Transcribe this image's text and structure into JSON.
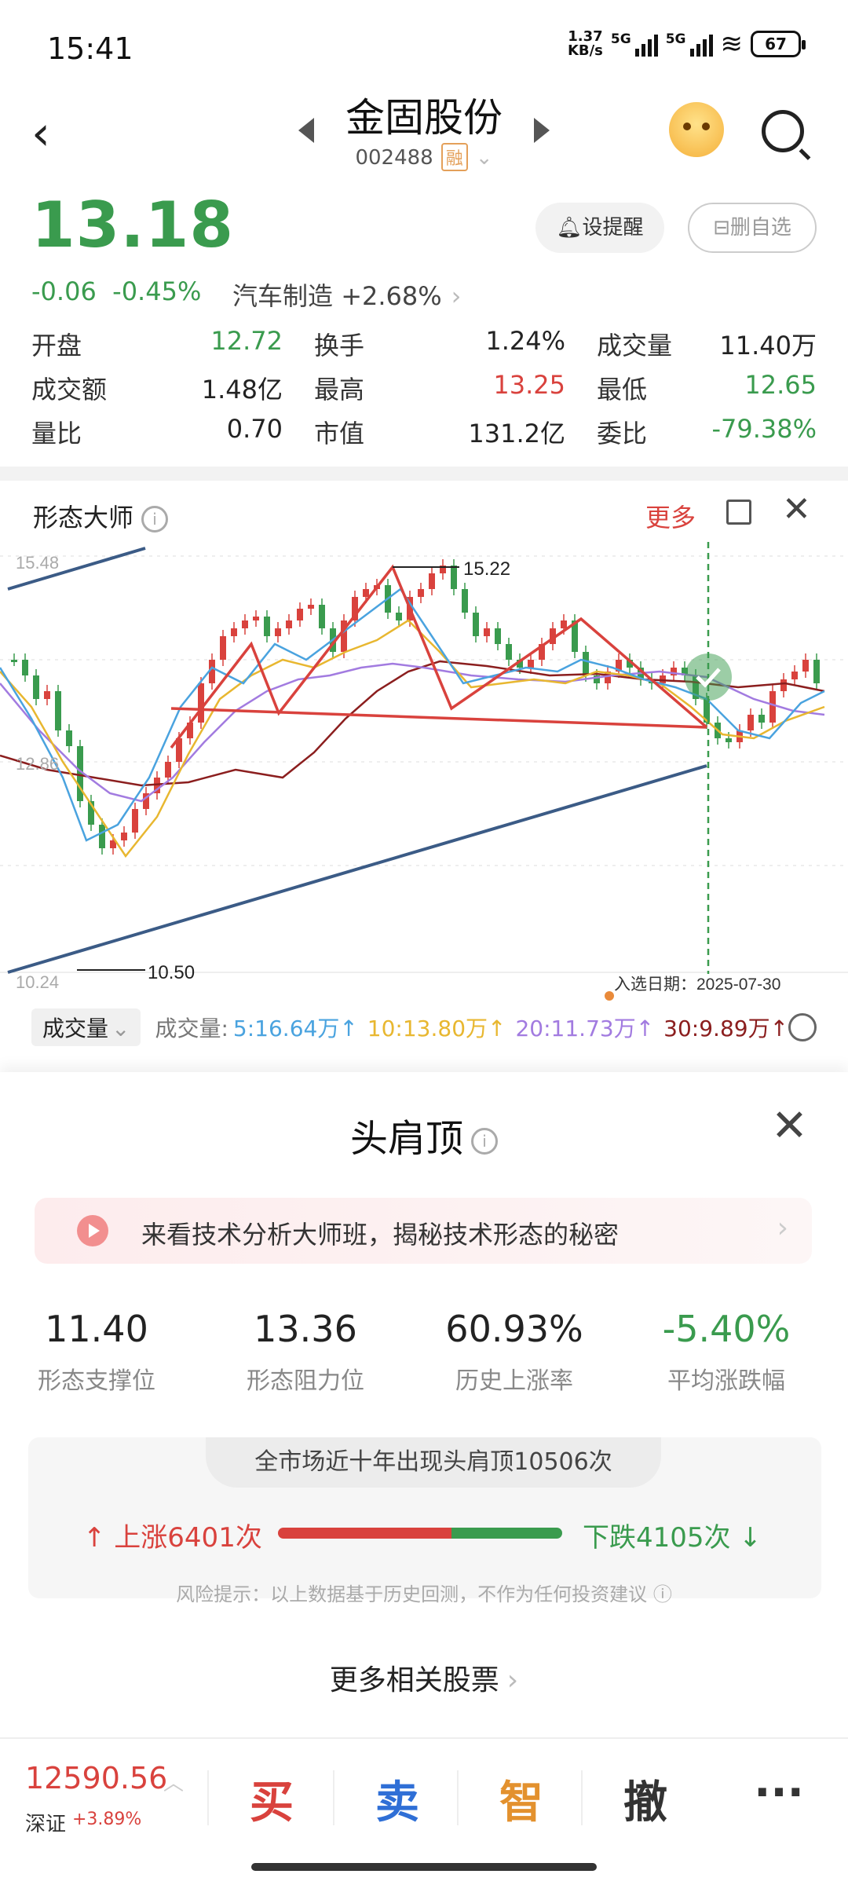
{
  "status_bar": {
    "time": "15:41",
    "net_speed_top": "1.37",
    "net_speed_unit": "KB/s",
    "sim1": "5G",
    "sim2": "5G",
    "battery": "67"
  },
  "header": {
    "stock_name": "金固股份",
    "stock_code": "002488",
    "margin_badge": "融"
  },
  "quote": {
    "price": "13.18",
    "change": "-0.06",
    "change_pct": "-0.45%",
    "sector": "汽车制造",
    "sector_change": "+2.68%",
    "alert_button": "设提醒",
    "remove_watch_button": "删自选",
    "stats": [
      [
        {
          "k": "开盘",
          "v": "12.72",
          "c": "green"
        },
        {
          "k": "换手",
          "v": "1.24%",
          "c": ""
        },
        {
          "k": "成交量",
          "v": "11.40万",
          "c": ""
        }
      ],
      [
        {
          "k": "成交额",
          "v": "1.48亿",
          "c": ""
        },
        {
          "k": "最高",
          "v": "13.25",
          "c": "red"
        },
        {
          "k": "最低",
          "v": "12.65",
          "c": "green"
        }
      ],
      [
        {
          "k": "量比",
          "v": "0.70",
          "c": ""
        },
        {
          "k": "市值",
          "v": "131.2亿",
          "c": ""
        },
        {
          "k": "委比",
          "v": "-79.38%",
          "c": "green"
        }
      ]
    ]
  },
  "pattern_master": {
    "title": "形态大师",
    "more": "更多",
    "y_top_label": "15.48",
    "y_mid_label": "12.86",
    "y_bottom_label": "10.24",
    "peak_label": "15.22",
    "trough_label": "10.50",
    "selected_date_label": "入选日期：2025-07-30"
  },
  "volume_bar": {
    "selector": "成交量",
    "label": "成交量:",
    "ma5": "5:16.64万↑",
    "ma10": "10:13.80万↑",
    "ma20": "20:11.73万↑",
    "ma30": "30:9.89万↑",
    "colors": {
      "ma5": "#4aa3df",
      "ma10": "#e8b730",
      "ma20": "#a27be0",
      "ma30": "#8b1e1e"
    }
  },
  "sheet": {
    "title": "头肩顶",
    "banner_text": "来看技术分析大师班，揭秘技术形态的秘密",
    "metrics": [
      {
        "value": "11.40",
        "label": "形态支撑位",
        "c": ""
      },
      {
        "value": "13.36",
        "label": "形态阻力位",
        "c": ""
      },
      {
        "value": "60.93%",
        "label": "历史上涨率",
        "c": ""
      },
      {
        "value": "-5.40%",
        "label": "平均涨跌幅",
        "c": "green"
      }
    ],
    "history_title": "全市场近十年出现头肩顶10506次",
    "up_text": "上涨6401次",
    "down_text": "下跌4105次",
    "up_ratio": 0.6093,
    "risk_note": "风险提示：以上数据基于历史回测，不作为任何投资建议",
    "more_related": "更多相关股票"
  },
  "bottom_bar": {
    "index_value": "12590.56",
    "index_name": "深证",
    "index_change": "+3.89%",
    "actions": [
      {
        "label": "买",
        "color": "#d9423d"
      },
      {
        "label": "卖",
        "color": "#2f6fd6"
      },
      {
        "label": "智",
        "color": "#e3912e"
      },
      {
        "label": "撤",
        "color": "#333333"
      }
    ],
    "more_icon": "more-dots-icon"
  }
}
